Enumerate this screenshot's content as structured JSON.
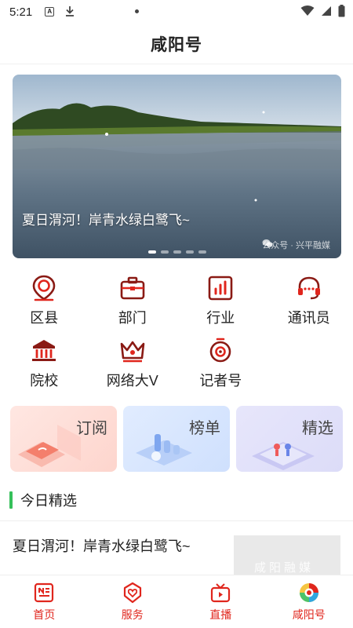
{
  "status_bar": {
    "time": "5:21"
  },
  "header": {
    "title": "咸阳号"
  },
  "banner": {
    "caption": "夏日渭河！岸青水绿白鹭飞~",
    "watermark": "公众号 · 兴平融媒",
    "page_count": 5,
    "active_page": 1
  },
  "grid": {
    "items": [
      {
        "label": "区县",
        "icon": "location-pin-icon"
      },
      {
        "label": "部门",
        "icon": "briefcase-icon"
      },
      {
        "label": "行业",
        "icon": "bar-chart-icon"
      },
      {
        "label": "通讯员",
        "icon": "headset-icon"
      },
      {
        "label": "院校",
        "icon": "institution-icon"
      },
      {
        "label": "网络大V",
        "icon": "crown-icon"
      },
      {
        "label": "记者号",
        "icon": "stopwatch-icon"
      }
    ]
  },
  "cards": [
    {
      "label": "订阅"
    },
    {
      "label": "榜单"
    },
    {
      "label": "精选"
    }
  ],
  "section": {
    "title": "今日精选"
  },
  "article": {
    "title": "夏日渭河！岸青水绿白鹭飞~",
    "thumb_text": "咸阳融媒"
  },
  "tabbar": {
    "items": [
      {
        "label": "首页",
        "icon": "news-icon"
      },
      {
        "label": "服务",
        "icon": "heart-shield-icon"
      },
      {
        "label": "直播",
        "icon": "tv-icon"
      },
      {
        "label": "咸阳号",
        "icon": "xianyang-logo-icon"
      }
    ]
  },
  "colors": {
    "accent": "#e0261d",
    "icon_dark": "#8a1a14",
    "section_bar": "#35c05a"
  }
}
